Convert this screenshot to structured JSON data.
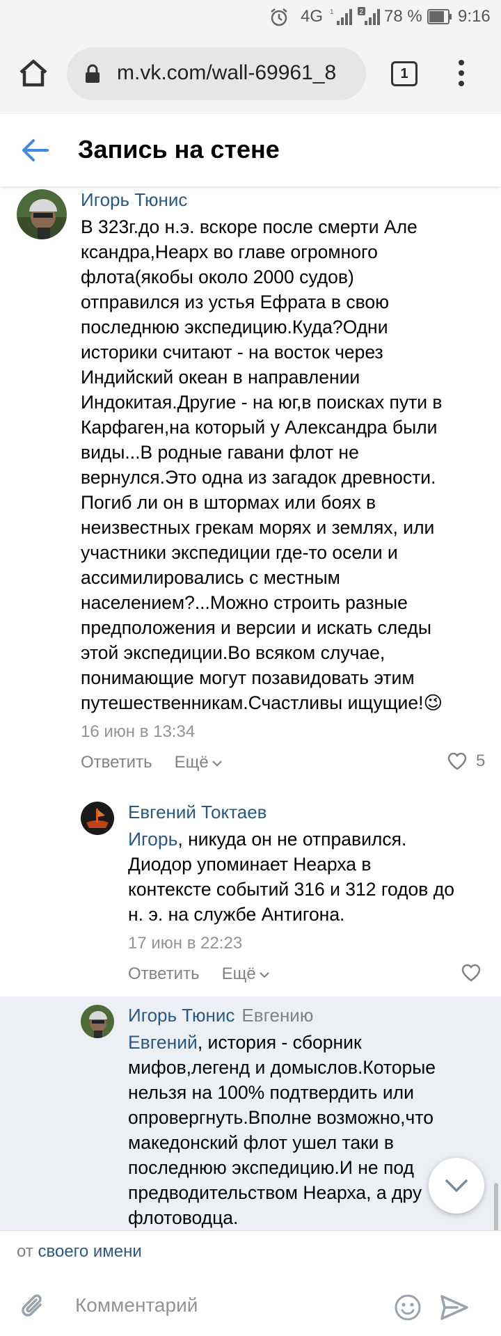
{
  "status_bar": {
    "network": "4G",
    "sim1": "1",
    "sim2": "2",
    "battery": "78 %",
    "time": "9:16"
  },
  "browser": {
    "url": "m.vk.com/wall-69961_8",
    "tab_count": "1"
  },
  "header": {
    "title": "Запись на стене"
  },
  "comments": [
    {
      "author": "Игорь Тюнис",
      "text": "В 323г.до н.э. вскоре после смерти Але\nксандра,Неарх во главе огромного\nфлота(якобы около 2000 судов)\nотправился из устья Ефрата в свою\nпоследнюю экспедицию.Куда?Одни\nисторики считают - на восток через\nИндийский океан в направлении\nИндокитая.Другие - на юг,в поисках пути в\nКарфаген,на который у Александра были\nвиды...В родные гавани флот не\nвернулся.Это одна из загадок древности.\nПогиб ли он в штормах или боях в\nнеизвестных грекам морях и землях, или\nучастники экспедиции где-то осели и\nассимилировались с местным\nнаселением?...Можно строить разные\nпредположения и версии и искать следы\nэтой экспедиции.Во всяком случае,\nпонимающие могут позавидовать этим\nпутешественникам.Счастливы ищущие!",
      "emoji": "😉",
      "date": "16 июн в 13:34",
      "reply_label": "Ответить",
      "more_label": "Ещё",
      "likes": "5"
    },
    {
      "author": "Евгений Токтаев",
      "mention": "Игорь",
      "text": ", никуда он не отправился.\nДиодор упоминает Неарха в\nконтексте событий 316 и 312 годов до\nн. э. на службе Антигона.",
      "date": "17 июн в 22:23",
      "reply_label": "Ответить",
      "more_label": "Ещё"
    },
    {
      "author": "Игорь Тюнис",
      "reply_to": "Евгению",
      "mention": "Евгений",
      "text": ", история - сборник\nмифов,легенд и домыслов.Которые\nнельзя на 100% подтвердить или\nопровергнуть.Вполне возможно,что\nмакедонский флот ушел таки в\nпоследнюю экспедицию.И не под\nпредводительством Неарха, а дру\nфлотоводца."
    }
  ],
  "composer": {
    "from_prefix": "от",
    "from_name": "своего имени",
    "placeholder": "Комментарий"
  }
}
